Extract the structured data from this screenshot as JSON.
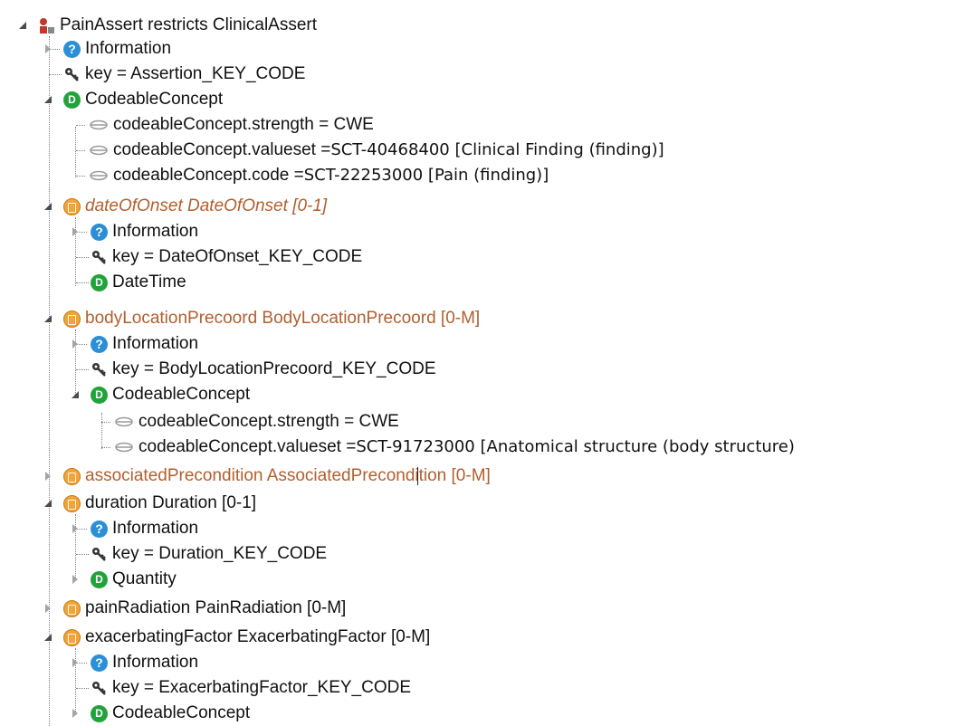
{
  "tree": {
    "root": {
      "label": "PainAssert restricts ClinicalAssert",
      "icon": "class-restriction-icon"
    },
    "n1": {
      "label": "Information",
      "icon": "info-icon"
    },
    "n2": {
      "label": "key = Assertion_KEY_CODE",
      "icon": "key-icon"
    },
    "n3": {
      "label": "CodeableConcept",
      "icon": "datatype-icon"
    },
    "n4": {
      "label_a": "codeableConcept.strength = CWE"
    },
    "n5": {
      "label_a": "codeableConcept.valueset = ",
      "label_b": "SCT-40468400 [Clinical Finding (finding)]"
    },
    "n6": {
      "label_a": "codeableConcept.code = ",
      "label_b": "SCT-22253000 [Pain (finding)]"
    },
    "n7": {
      "label": "dateOfOnset DateOfOnset [0-1]",
      "icon": "attribute-icon"
    },
    "n8": {
      "label": "Information"
    },
    "n9": {
      "label": "key = DateOfOnset_KEY_CODE"
    },
    "n10": {
      "label": "DateTime"
    },
    "n11": {
      "label": "bodyLocationPrecoord BodyLocationPrecoord [0-M]"
    },
    "n12": {
      "label": "Information"
    },
    "n13": {
      "label": "key = BodyLocationPrecoord_KEY_CODE"
    },
    "n14": {
      "label": "CodeableConcept"
    },
    "n15": {
      "label_a": "codeableConcept.strength = CWE"
    },
    "n16": {
      "label_a": "codeableConcept.valueset = ",
      "label_b": "SCT-91723000 [Anatomical structure (body structure)"
    },
    "n17": {
      "label": "associatedPrecondition AssociatedPrecondition [0-M]"
    },
    "n18": {
      "label": "duration Duration [0-1]"
    },
    "n19": {
      "label": "Information"
    },
    "n20": {
      "label": "key = Duration_KEY_CODE"
    },
    "n21": {
      "label": "Quantity"
    },
    "n22": {
      "label": "painRadiation PainRadiation [0-M]"
    },
    "n23": {
      "label": "exacerbatingFactor ExacerbatingFactor [0-M]"
    },
    "n24": {
      "label": "Information"
    },
    "n25": {
      "label": "key = ExacerbatingFactor_KEY_CODE"
    },
    "n26": {
      "label": "CodeableConcept"
    }
  },
  "icons": {
    "info_glyph": "?",
    "datatype_glyph": "D"
  },
  "colors": {
    "attribute_text": "#b25f2e",
    "info_icon": "#2a8fd6",
    "datatype_icon": "#21a33a",
    "attribute_icon": "#f0a43a"
  }
}
